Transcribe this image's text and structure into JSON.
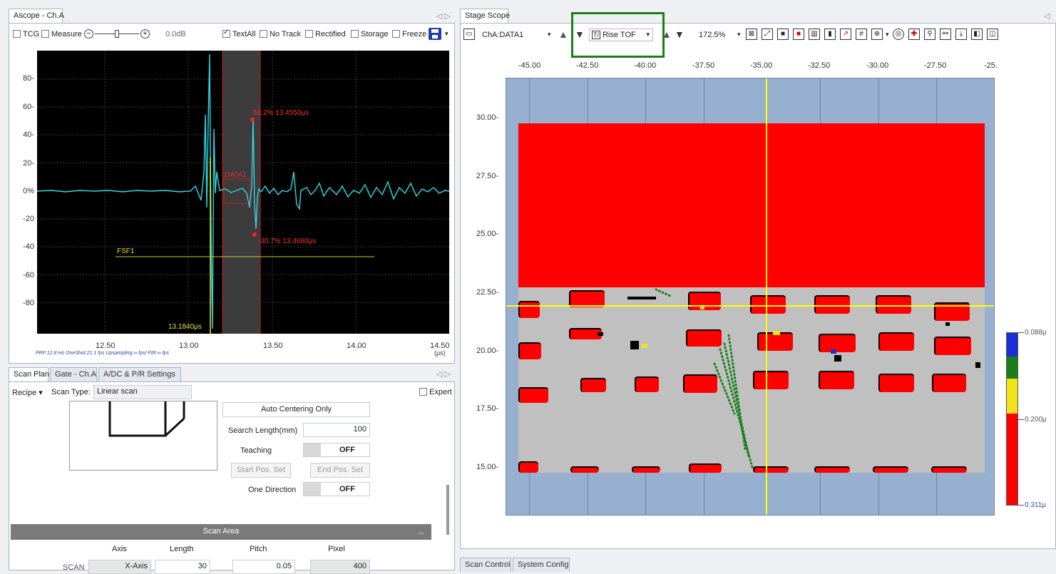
{
  "ascope": {
    "tab_label": "Ascope - Ch.A",
    "toolbar": {
      "tcg": "TCG",
      "measure": "Measure",
      "gain": "0.0dB",
      "textall": "TextAll",
      "no_track": "No Track",
      "rectified": "Rectified",
      "storage": "Storage",
      "freeze": "Freeze"
    },
    "y_ticks": [
      "80-",
      "60-",
      "40-",
      "20-",
      "0%",
      "-20",
      "-40",
      "-60",
      "-80"
    ],
    "x_ticks": [
      "12.50",
      "13.00",
      "13.50",
      "14.00",
      "14.50"
    ],
    "x_unit": "(μs)",
    "status_line": "PRF:12.8 Hz  OneShot:21.1 fps  Upsampling:∞ fps/  FIR:∞ fps",
    "annotations": {
      "peak_top": "51.2% 13.4550μs",
      "peak_bottom": "-30.7% 13.4680μs",
      "gate_label": "DATA1",
      "fsf_label": "FSF1",
      "cursor_time": "13.1840μs"
    }
  },
  "scan_plan": {
    "tabs": [
      "Scan Plan",
      "Gate - Ch.A",
      "A/DC & P/R Settings"
    ],
    "recipe_label": "Recipe",
    "scan_type_label": "Scan Type:",
    "scan_type_value": "Linear scan",
    "expert_label": "Expert",
    "auto_centering": "Auto Centering Only",
    "search_length_label": "Search Length(mm)",
    "search_length_value": "100",
    "teaching_label": "Teaching",
    "teaching_value": "OFF",
    "start_pos": "Start Pos. Set",
    "end_pos": "End Pos. Set",
    "one_direction_label": "One Direction",
    "one_direction_value": "OFF",
    "scan_area_header": "Scan Area",
    "columns": [
      "Axis",
      "Length",
      "Pitch",
      "Pixel"
    ],
    "row_scan": {
      "name": "SCAN",
      "axis": "X-Axis",
      "length": "30",
      "pitch": "0.05",
      "pixel": "400"
    }
  },
  "stage_scope": {
    "tab_label": "Stage Scope",
    "channel": "ChA:DATA1",
    "mode": "Rise TOF",
    "zoom": "172.5%",
    "x_ticks": [
      "-45.00",
      "-42.50",
      "-40.00",
      "-37.50",
      "-35.00",
      "-32.50",
      "-30.00",
      "-27.50",
      "-25."
    ],
    "y_ticks": [
      "30.00-",
      "27.50-",
      "25.00-",
      "22.50-",
      "20.00-",
      "17.50-",
      "15.00-"
    ],
    "legend": [
      "0.088μ",
      "0.200μ",
      "0.311μ"
    ],
    "colors": {
      "red": "#ff0000",
      "gray": "#c0c0c0",
      "blue_bg": "#97b0cf",
      "yellow": "#ffff00",
      "green": "#0a7a0a",
      "highlight": "#1a7f1a"
    }
  },
  "bottom_tabs": [
    "Scan Control",
    "System Config"
  ]
}
